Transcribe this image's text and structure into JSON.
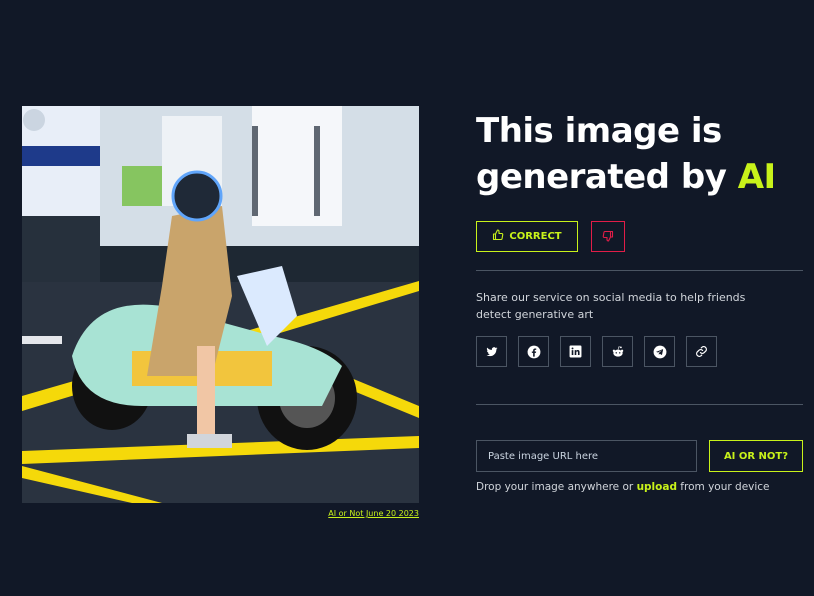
{
  "image": {
    "alt": "Woman in trench coat and helmet sitting on a mint-green scooter",
    "caption": "AI or Not June 20 2023"
  },
  "result": {
    "title_line1": "This image is",
    "title_line2_prefix": "generated by ",
    "title_highlight": "AI"
  },
  "feedback": {
    "correct_label": "CORRECT",
    "correct_icon": "thumbs-up-icon",
    "wrong_icon": "thumbs-down-icon"
  },
  "share": {
    "text": "Share our service on social media to help friends detect generative art",
    "icons": [
      "twitter-icon",
      "facebook-icon",
      "linkedin-icon",
      "reddit-icon",
      "telegram-icon",
      "link-icon"
    ]
  },
  "upload": {
    "placeholder": "Paste image URL here",
    "button_label": "AI OR NOT?",
    "drop_prefix": "Drop your image anywhere or ",
    "upload_link": "upload",
    "drop_suffix": " from your device"
  },
  "colors": {
    "background": "#111827",
    "accent": "#c8f21a",
    "danger": "#e11d48",
    "border": "#4b5563"
  }
}
